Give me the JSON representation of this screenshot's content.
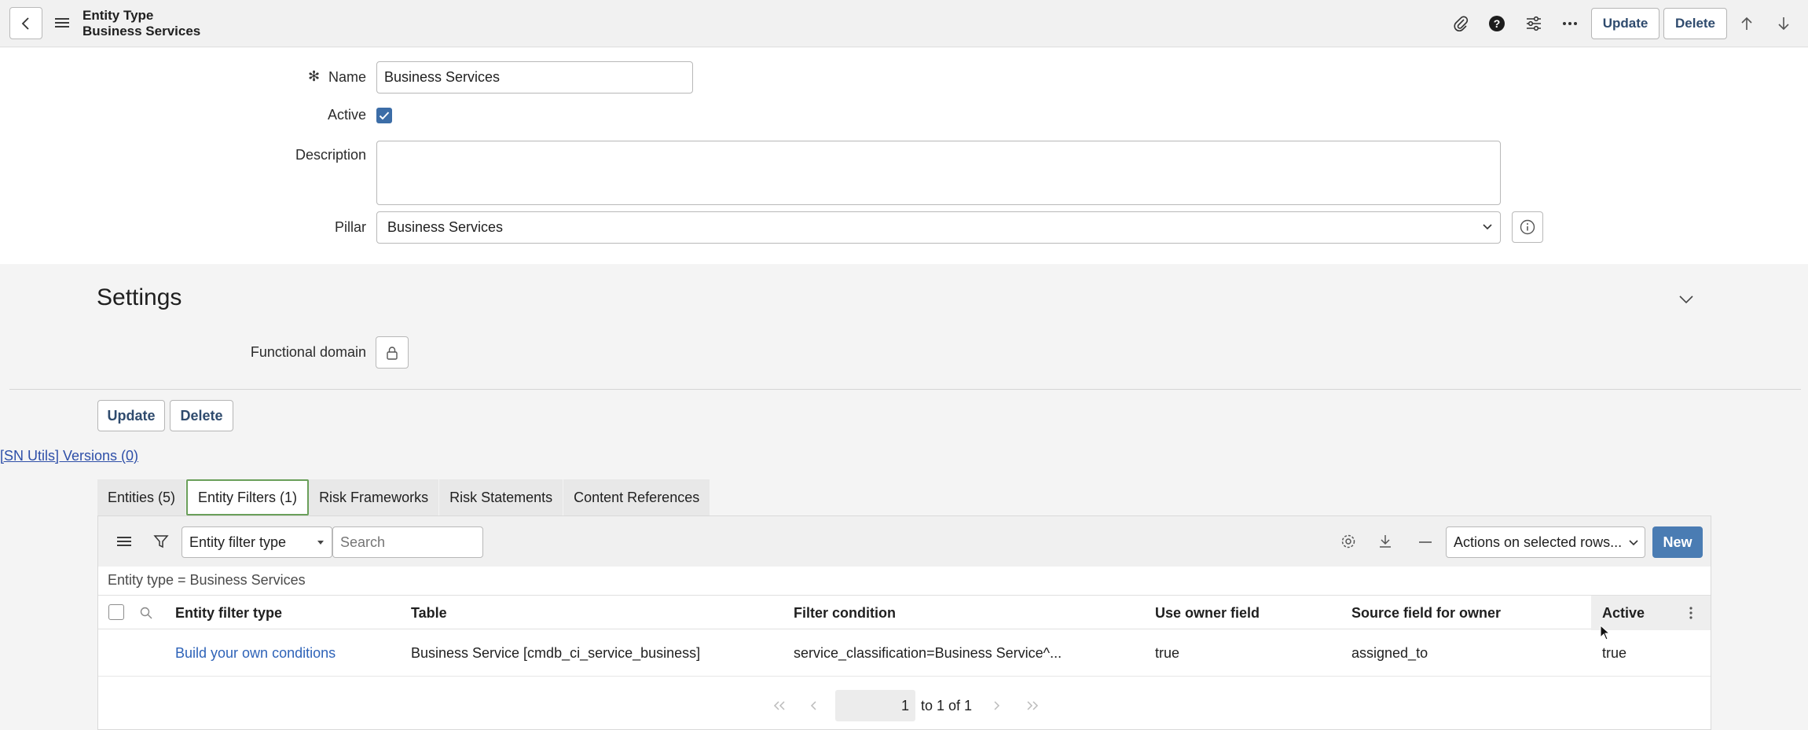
{
  "header": {
    "title": "Entity Type",
    "subtitle": "Business Services",
    "update_label": "Update",
    "delete_label": "Delete"
  },
  "form": {
    "name_label": "Name",
    "name_required_mark": "✻",
    "name_value": "Business Services",
    "active_label": "Active",
    "active_checked": true,
    "description_label": "Description",
    "description_value": "",
    "pillar_label": "Pillar",
    "pillar_value": "Business Services"
  },
  "settings": {
    "title": "Settings",
    "functional_domain_label": "Functional domain"
  },
  "actions": {
    "update_label": "Update",
    "delete_label": "Delete"
  },
  "sn_utils_link": "[SN Utils] Versions (0)",
  "tabs": [
    {
      "label": "Entities (5)",
      "active": false
    },
    {
      "label": "Entity Filters (1)",
      "active": true
    },
    {
      "label": "Risk Frameworks",
      "active": false
    },
    {
      "label": "Risk Statements",
      "active": false
    },
    {
      "label": "Content References",
      "active": false
    }
  ],
  "list": {
    "search_field_select": "Entity filter type",
    "search_placeholder": "Search",
    "actions_select": "Actions on selected rows...",
    "new_label": "New",
    "breadcrumb": "Entity type = Business Services",
    "columns": [
      "Entity filter type",
      "Table",
      "Filter condition",
      "Use owner field",
      "Source field for owner",
      "Active"
    ],
    "rows": [
      [
        "Build your own conditions",
        "Business Service [cmdb_ci_service_business]",
        "service_classification=Business Service^...",
        "true",
        "assigned_to",
        "true"
      ]
    ],
    "pager": {
      "current": "1",
      "range_text": "to 1 of 1"
    }
  },
  "colors": {
    "accent": "#4a7cb3",
    "button_text": "#2f4b6e",
    "link": "#2e63b8",
    "active_tab_border": "#6a9f5a"
  }
}
